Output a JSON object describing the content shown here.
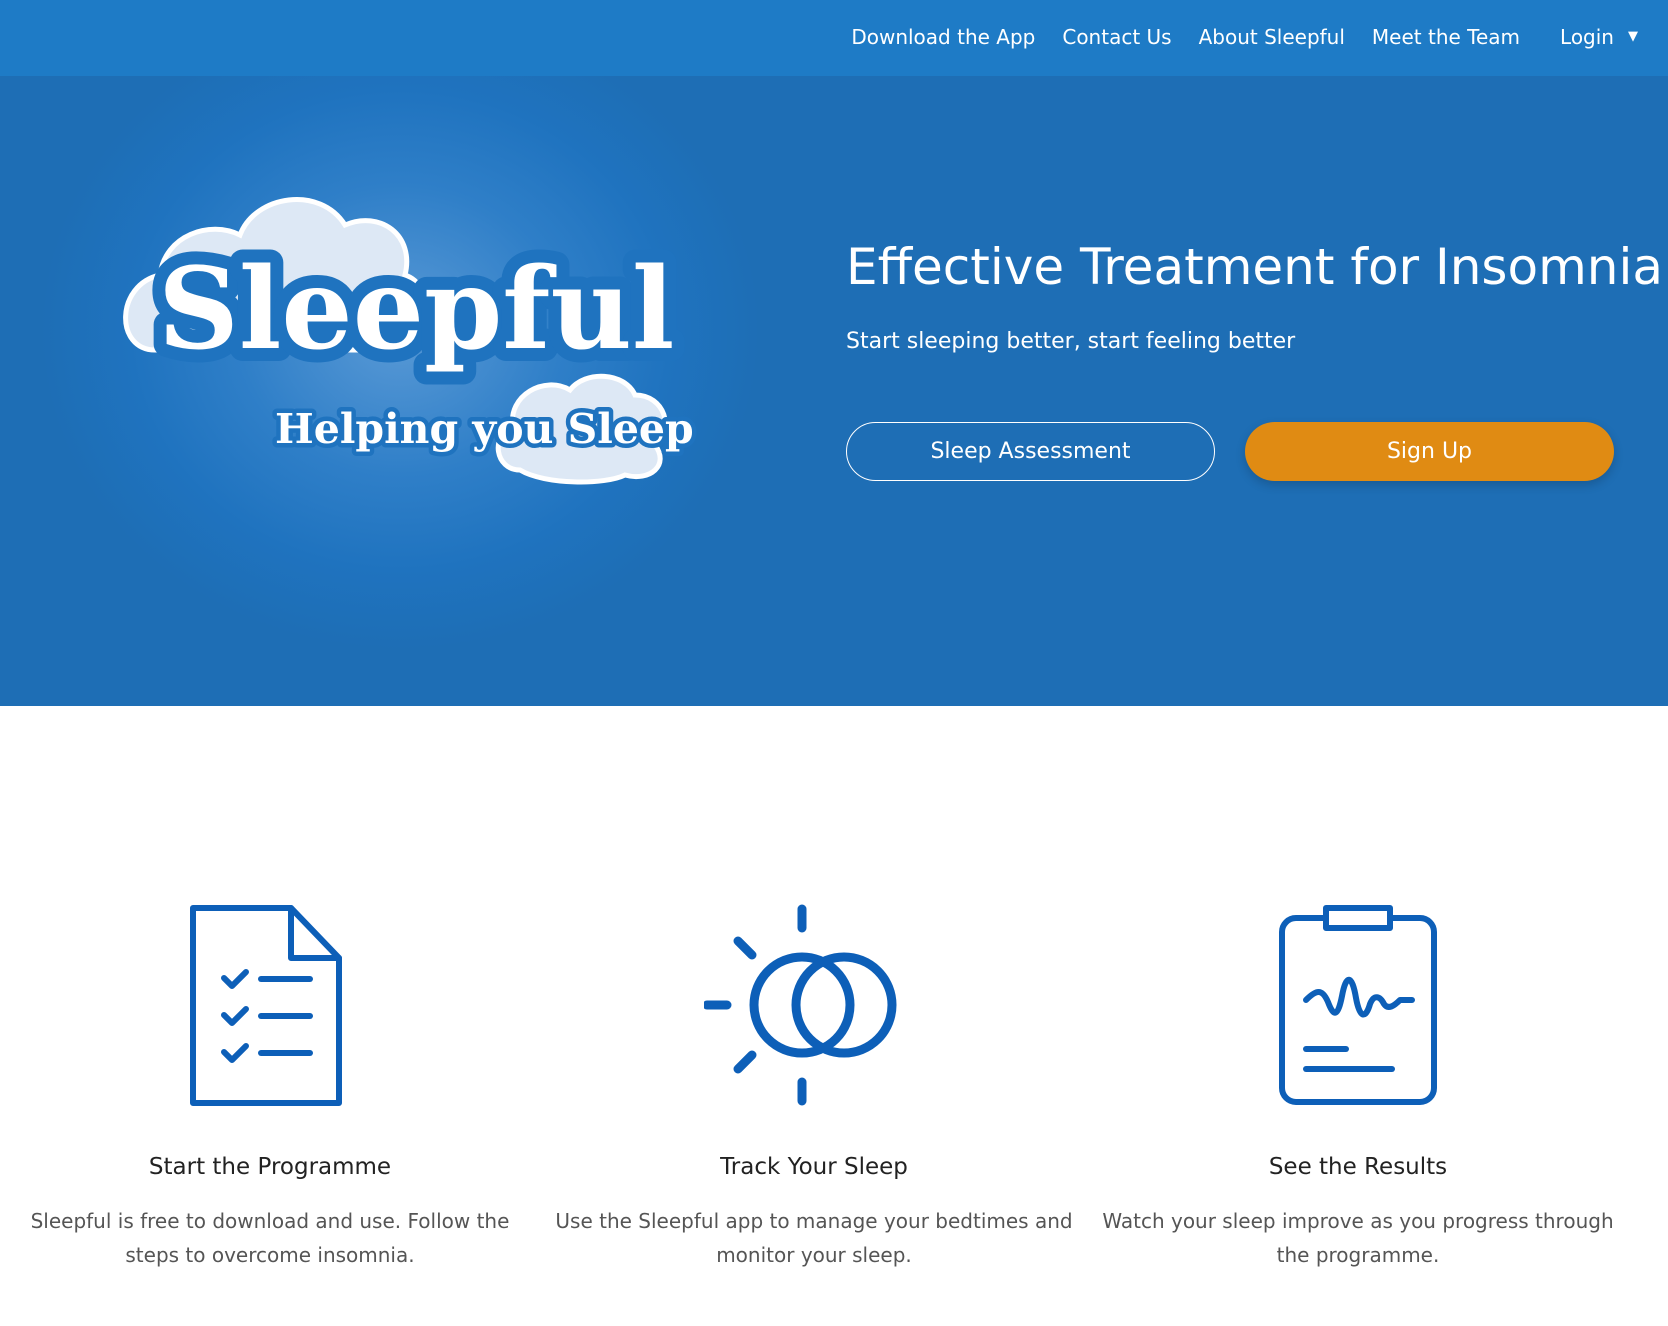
{
  "nav": {
    "items": [
      {
        "label": "Download the App"
      },
      {
        "label": "Contact Us"
      },
      {
        "label": "About Sleepful"
      },
      {
        "label": "Meet the Team"
      }
    ],
    "login_label": "Login",
    "caret_icon": "caret-down-icon"
  },
  "logo": {
    "wordmark": "Sleepful",
    "tagline": "Helping you Sleep",
    "icon": "cloud-icon"
  },
  "hero": {
    "headline": "Effective Treatment for Insomnia",
    "subline": "Start sleeping better, start feeling better",
    "assessment_label": "Sleep Assessment",
    "signup_label": "Sign Up"
  },
  "features": [
    {
      "icon": "checklist-document-icon",
      "title": "Start the Programme",
      "description": "Sleepful is free to download and use. Follow the steps to overcome insomnia."
    },
    {
      "icon": "sun-moon-icon",
      "title": "Track Your Sleep",
      "description": "Use the Sleepful app to manage your bedtimes and monitor your sleep."
    },
    {
      "icon": "clipboard-chart-icon",
      "title": "See the Results",
      "description": "Watch your sleep improve as you progress through the programme."
    }
  ],
  "colors": {
    "hero_blue": "#1e73bf",
    "accent_orange": "#e08b13",
    "icon_blue": "#0d5fb8"
  }
}
